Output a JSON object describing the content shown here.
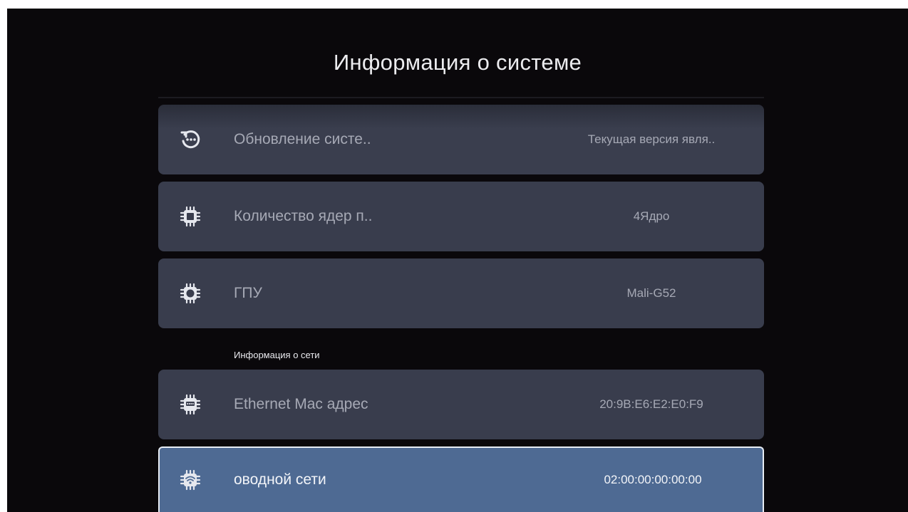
{
  "page_title": "Информация о системе",
  "system_items": [
    {
      "label": "Обновление систе..",
      "value": "Текущая версия явля..",
      "icon": "system-update-icon"
    },
    {
      "label": "Количество ядер п..",
      "value": "4Ядро",
      "icon": "cpu-chip-icon"
    },
    {
      "label": "ГПУ",
      "value": "Mali-G52",
      "icon": "gpu-chip-icon"
    }
  ],
  "network_section": {
    "title": "Информация о сети",
    "items": [
      {
        "label": "Ethernet Mac адрес",
        "value": "20:9B:E6:E2:E0:F9",
        "icon": "ethernet-chip-icon"
      },
      {
        "label": "оводной сети",
        "value": "02:00:00:00:00:00",
        "icon": "wifi-chip-icon",
        "selected": true
      }
    ]
  },
  "colors": {
    "background": "#0a080b",
    "row": "#393d4d",
    "row_selected": "#4e6a93",
    "text_dim": "#a6a9b5",
    "text_bright": "#f3f5f9"
  }
}
